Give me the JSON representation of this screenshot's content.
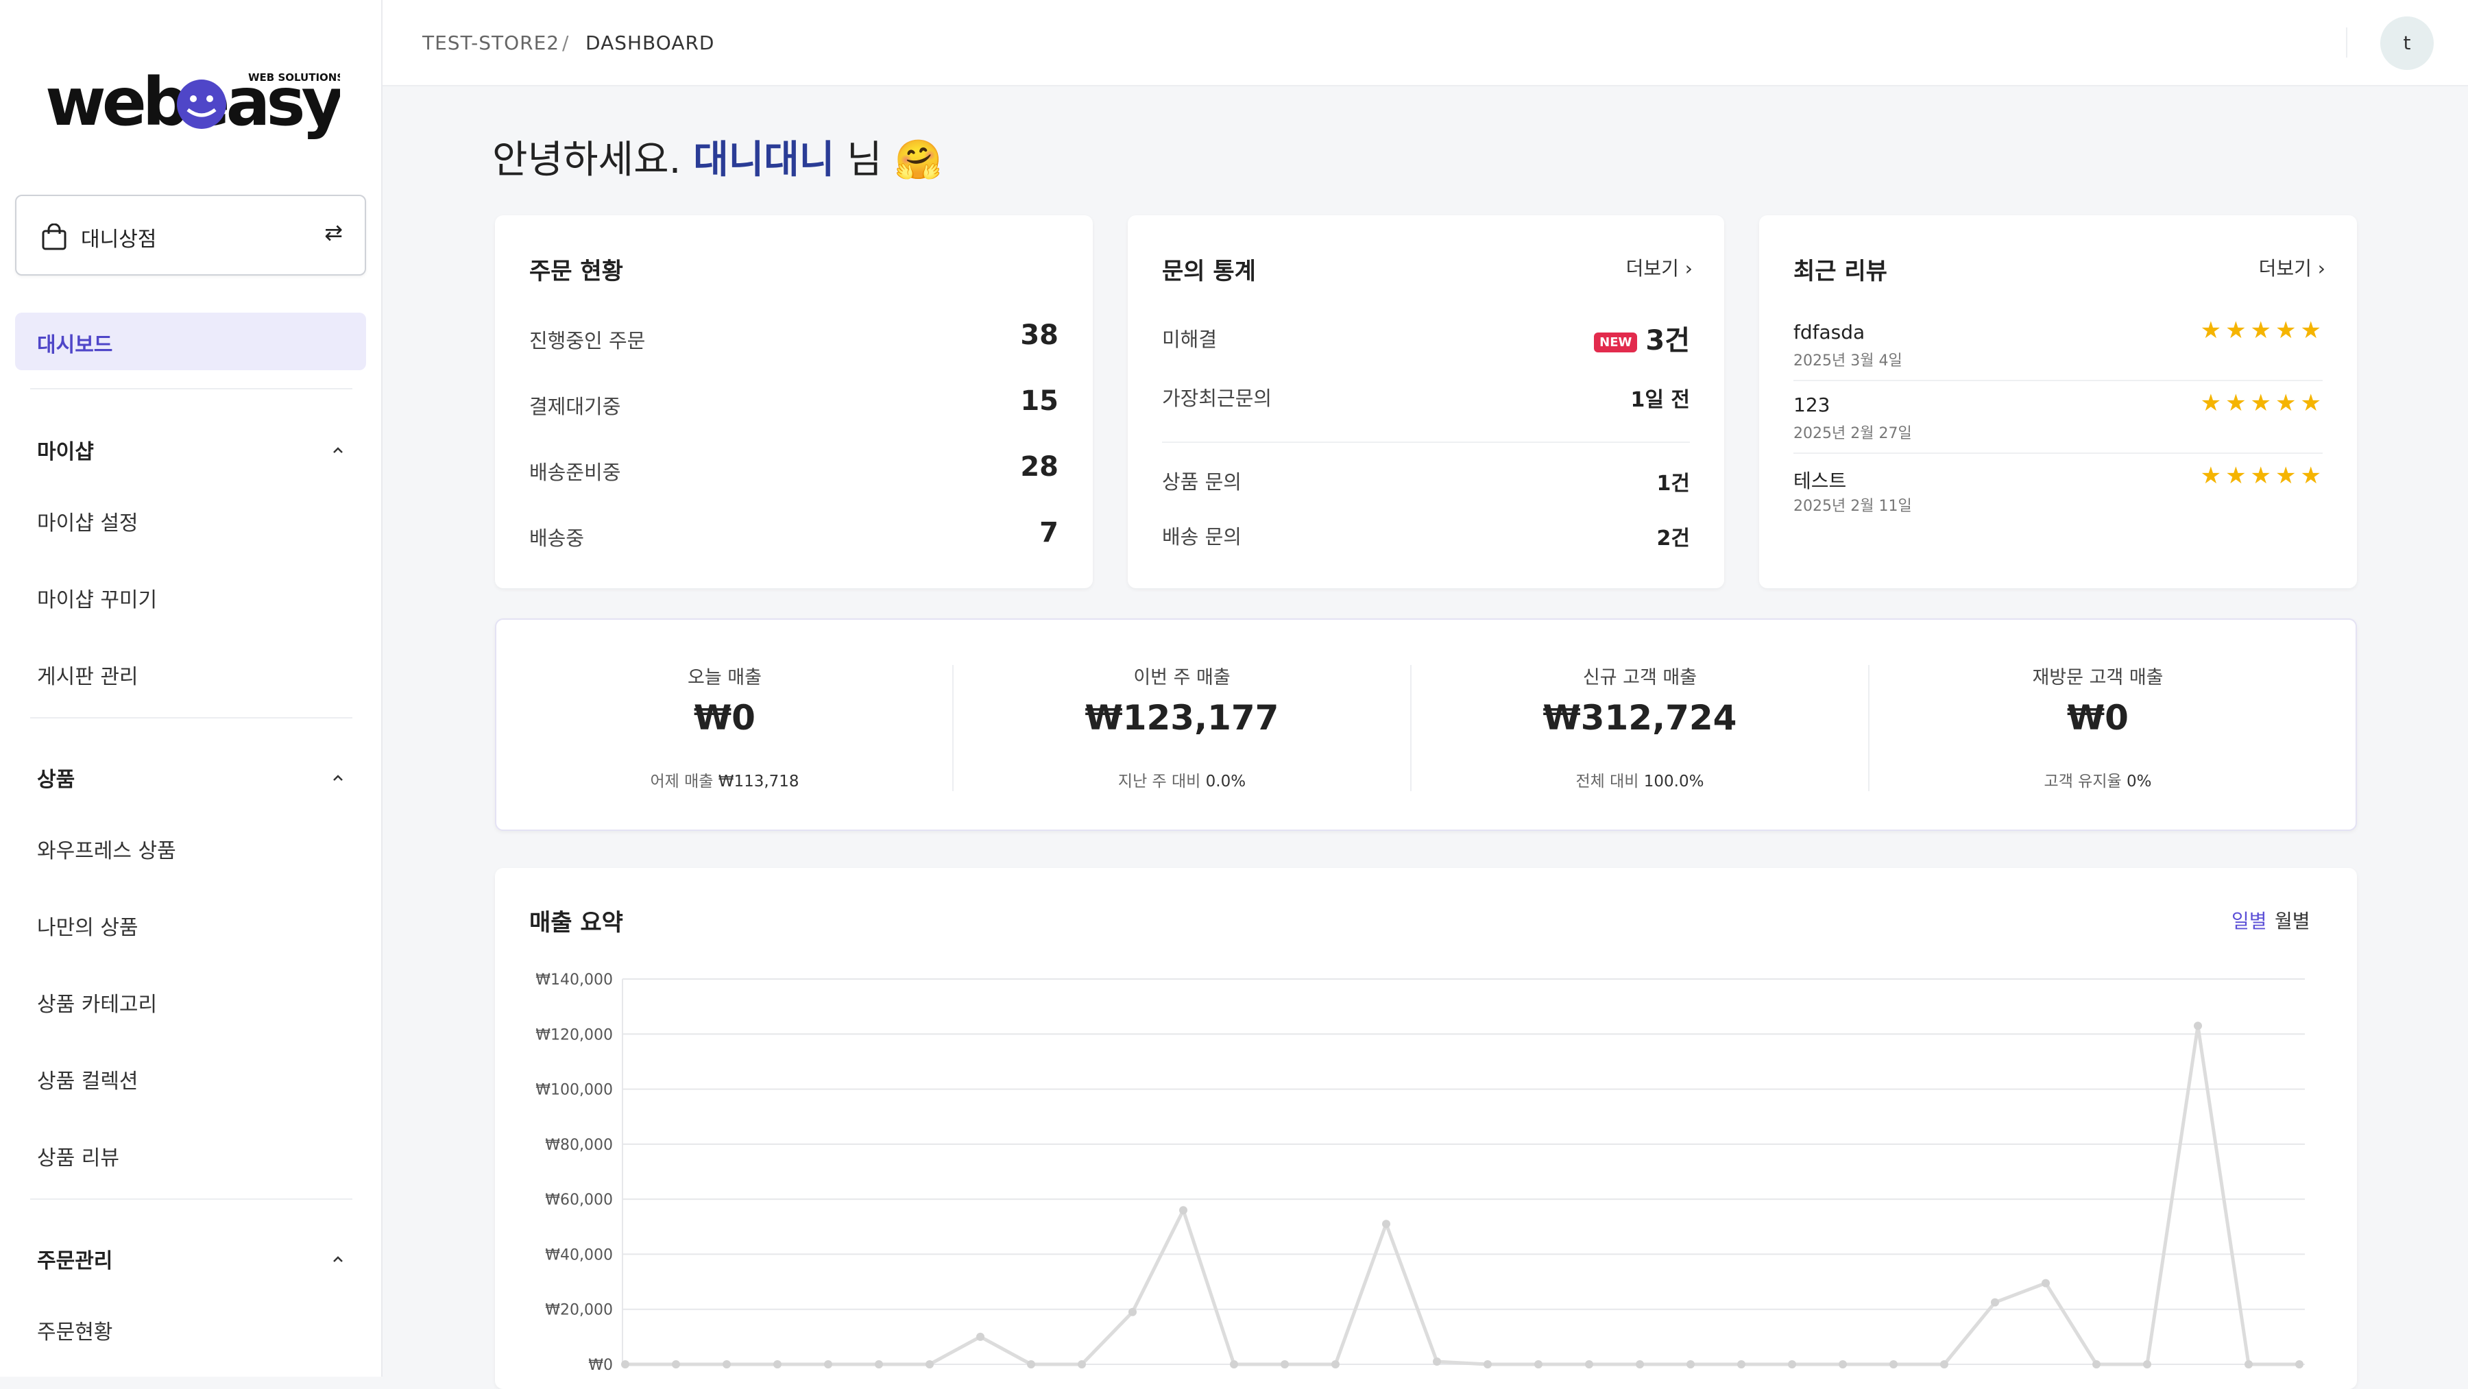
{
  "brand": {
    "logo_text": "webeasy",
    "logo_tagline": "WEB SOLUTIONS"
  },
  "store_switcher": {
    "label": "대니상점",
    "bag_icon": "shopping-bag-icon",
    "swap_icon": "swap-icon"
  },
  "sidebar": {
    "active_item": "대시보드",
    "sections": [
      {
        "title": "마이샵",
        "items": [
          "마이샵 설정",
          "마이샵 꾸미기",
          "게시판 관리"
        ]
      },
      {
        "title": "상품",
        "items": [
          "와우프레스 상품",
          "나만의 상품",
          "상품 카테고리",
          "상품 컬렉션",
          "상품 리뷰"
        ]
      },
      {
        "title": "주문관리",
        "items": [
          "주문현황"
        ]
      }
    ]
  },
  "topbar": {
    "breadcrumb": [
      "TEST-STORE2",
      "DASHBOARD"
    ],
    "separator": "/",
    "avatar_initial": "t"
  },
  "greeting": {
    "prefix": "안녕하세요.",
    "name": "대니대니",
    "suffix": "님",
    "emoji": "🤗"
  },
  "order_status": {
    "title": "주문 현황",
    "rows": [
      {
        "label": "진행중인 주문",
        "value": "38"
      },
      {
        "label": "결제대기중",
        "value": "15"
      },
      {
        "label": "배송준비중",
        "value": "28"
      },
      {
        "label": "배송중",
        "value": "7"
      }
    ]
  },
  "inquiry_stats": {
    "title": "문의 통계",
    "more_label": "더보기",
    "badge": "NEW",
    "rows": [
      {
        "label": "미해결",
        "value": "3건"
      },
      {
        "label": "가장최근문의",
        "value": "1일 전"
      },
      {
        "label": "상품 문의",
        "value": "1건"
      },
      {
        "label": "배송 문의",
        "value": "2건"
      }
    ]
  },
  "recent_reviews": {
    "title": "최근 리뷰",
    "more_label": "더보기",
    "items": [
      {
        "name": "fdfasda",
        "date": "2025년 3월 4일",
        "rating": 5,
        "stars": "★★★★★"
      },
      {
        "name": "123",
        "date": "2025년 2월 27일",
        "rating": 5,
        "stars": "★★★★★"
      },
      {
        "name": "테스트",
        "date": "2025년 2월 11일",
        "rating": 5,
        "stars": "★★★★★"
      }
    ]
  },
  "sales_stats": [
    {
      "label": "오늘 매출",
      "value": "₩0",
      "sub_label": "어제 매출",
      "sub_value": "₩113,718"
    },
    {
      "label": "이번 주 매출",
      "value": "₩123,177",
      "sub_label": "지난 주 대비",
      "sub_value": "0.0%"
    },
    {
      "label": "신규 고객 매출",
      "value": "₩312,724",
      "sub_label": "전체 대비",
      "sub_value": "100.0%"
    },
    {
      "label": "재방문 고객 매출",
      "value": "₩0",
      "sub_label": "고객 유지율",
      "sub_value": "0%"
    }
  ],
  "sales_summary": {
    "title": "매출 요약",
    "tabs": [
      "일별",
      "월별"
    ],
    "active_tab": "일별"
  },
  "colors": {
    "accent": "#5b4fd6",
    "name_highlight": "#2a3c96",
    "star": "#f5b400",
    "badge": "#e22b4d",
    "line": "#dcdcdc"
  },
  "chart_data": {
    "type": "line",
    "ylim": [
      0,
      140000
    ],
    "y_ticks": [
      "₩0",
      "₩20,000",
      "₩40,000",
      "₩60,000",
      "₩80,000",
      "₩100,000",
      "₩120,000",
      "₩140,000"
    ],
    "grid": true,
    "series": [
      {
        "values": [
          0,
          0,
          0,
          0,
          0,
          0,
          0,
          10000,
          0,
          0,
          19000,
          56000,
          0,
          0,
          0,
          51000,
          1000,
          0,
          0,
          0,
          0,
          0,
          0,
          0,
          0,
          0,
          0,
          22500,
          29500,
          0,
          0,
          123000,
          0,
          0
        ]
      }
    ]
  }
}
